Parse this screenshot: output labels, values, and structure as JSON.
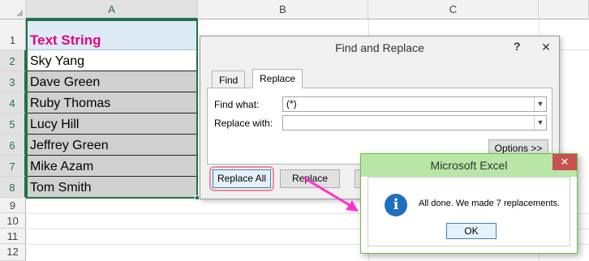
{
  "sheet": {
    "columns": [
      "A",
      "B",
      "C"
    ],
    "rows": [
      "1",
      "2",
      "3",
      "4",
      "5",
      "6",
      "7",
      "8",
      "9",
      "10",
      "11",
      "12"
    ],
    "header_cell": "Text String",
    "cells": [
      "Sky Yang",
      "Dave Green",
      "Ruby Thomas",
      "Lucy Hill",
      "Jeffrey Green",
      "Mike Azam",
      "Tom Smith"
    ]
  },
  "dialog": {
    "title": "Find and Replace",
    "help": "?",
    "close": "✕",
    "tabs": [
      "Find",
      "Replace"
    ],
    "find_label": "Find what:",
    "find_value": "(*)",
    "replace_label": "Replace with:",
    "replace_value": "",
    "options_button": "Options >>",
    "replace_all_button": "Replace All",
    "replace_button": "Replace"
  },
  "message": {
    "title": "Microsoft Excel",
    "close": "✕",
    "text": "All done. We made 7 replacements.",
    "ok_button": "OK",
    "icon": "info-icon"
  },
  "colors": {
    "accent_green": "#217346",
    "header_text": "#e6007e",
    "arrow": "#ff33cc",
    "highlight_ring": "#f08aa0"
  }
}
